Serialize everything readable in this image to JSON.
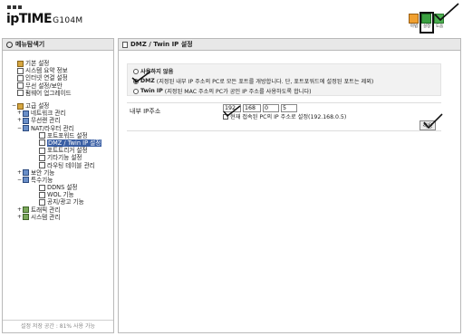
{
  "header": {
    "brand": "ipTIME",
    "model": "G104M",
    "icons": [
      {
        "name": "home-icon",
        "label": "마법",
        "color": "#f0a030"
      },
      {
        "name": "setup-icon",
        "label": "설정",
        "color": "#3aa040",
        "selected": true
      },
      {
        "name": "help-icon",
        "label": "도움",
        "color": "#4caf50"
      }
    ]
  },
  "sidebar": {
    "title": "메뉴탐색기",
    "footer": "설정 저장 공간 : 81% 사용 가능",
    "tree": [
      {
        "label": "기본 설정",
        "icon": "fold2",
        "indent": 0,
        "pm": ""
      },
      {
        "label": "시스템 요약 정보",
        "icon": "doc",
        "indent": 1
      },
      {
        "label": "인터넷 연결 설정",
        "icon": "doc",
        "indent": 1
      },
      {
        "label": "무선 설정/보안",
        "icon": "doc",
        "indent": 1
      },
      {
        "label": "펌웨어 업그레이드",
        "icon": "doc",
        "indent": 1
      },
      {
        "label": "",
        "icon": "",
        "indent": 0,
        "spacer": true
      },
      {
        "label": "고급 설정",
        "icon": "fold2",
        "indent": 0,
        "pm": "−"
      },
      {
        "label": "네트워크 관리",
        "icon": "folder",
        "indent": 1,
        "pm": "+"
      },
      {
        "label": "무선랜 관리",
        "icon": "folder",
        "indent": 1,
        "pm": "+"
      },
      {
        "label": "NAT/라우터 관리",
        "icon": "folder",
        "indent": 1,
        "pm": "−"
      },
      {
        "label": "포트포워드 설정",
        "icon": "doc",
        "indent": 2
      },
      {
        "label": "DMZ / Twin IP 설정",
        "icon": "doc",
        "indent": 2,
        "current": true
      },
      {
        "label": "포트트리거 설정",
        "icon": "doc",
        "indent": 2
      },
      {
        "label": "기타기능 설정",
        "icon": "doc",
        "indent": 2
      },
      {
        "label": "라우팅 테이블 관리",
        "icon": "doc",
        "indent": 2
      },
      {
        "label": "보안 기능",
        "icon": "folder",
        "indent": 1,
        "pm": "+"
      },
      {
        "label": "특수기능",
        "icon": "folder",
        "indent": 1,
        "pm": "−"
      },
      {
        "label": "DDNS 설정",
        "icon": "doc",
        "indent": 2
      },
      {
        "label": "WOL 기능",
        "icon": "doc",
        "indent": 2
      },
      {
        "label": "공지/광고 기능",
        "icon": "doc",
        "indent": 2
      },
      {
        "label": "트래픽 관리",
        "icon": "tool",
        "indent": 1,
        "pm": "+"
      },
      {
        "label": "시스템 관리",
        "icon": "tool",
        "indent": 1,
        "pm": "+"
      }
    ]
  },
  "main": {
    "title": "DMZ / Twin IP 설정",
    "options": [
      {
        "bold": "사용하지 않음",
        "desc": "",
        "selected": false
      },
      {
        "bold": "DMZ",
        "desc": "(지정된 내부 IP 주소의 PC로 모든 포트를 개방합니다. 단, 포트포워드에 설정된 포트는 제외)",
        "selected": true
      },
      {
        "bold": "Twin IP",
        "desc": "(지정된 MAC 주소의 PC가 공인 IP 주소를 사용하도록 합니다)",
        "selected": false
      }
    ],
    "ip_label": "내부 IP주소",
    "ip": [
      "192",
      "168",
      "0",
      "5"
    ],
    "checkbox_label": "현재 접속된 PC의 IP 주소로 설정(192.168.0.5)",
    "apply_label": "적용"
  }
}
